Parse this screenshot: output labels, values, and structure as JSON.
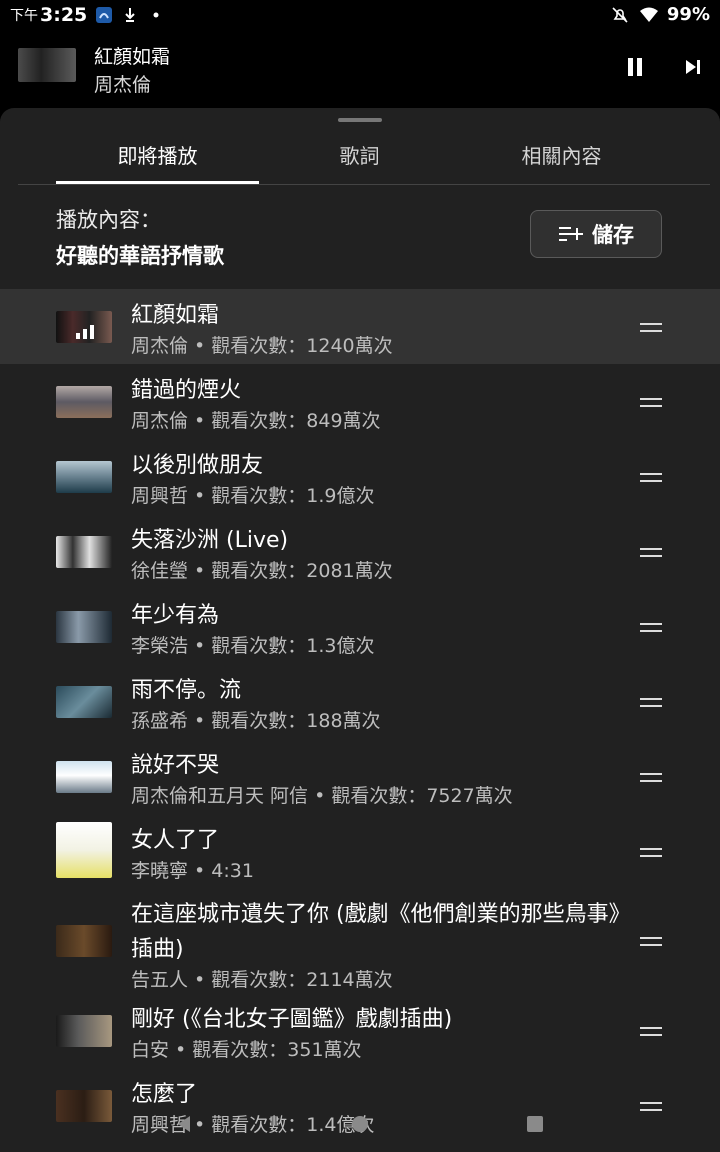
{
  "status_bar": {
    "time_prefix": "下午",
    "time": "3:25",
    "battery": "99%",
    "icons_left": [
      "app-notification-icon",
      "download-icon",
      "dot-icon"
    ],
    "icons_right": [
      "mute-icon",
      "wifi-icon",
      "battery-icon"
    ]
  },
  "mini_player": {
    "title": "紅顏如霜",
    "artist": "周杰倫"
  },
  "tabs": [
    {
      "label": "即將播放"
    },
    {
      "label": "歌詞"
    },
    {
      "label": "相關內容"
    }
  ],
  "playlist": {
    "label": "播放內容：",
    "name": "好聽的華語抒情歌",
    "save_label": "儲存"
  },
  "items": [
    {
      "title": "紅顏如霜",
      "meta": "周杰倫 • 觀看次數：1240萬次"
    },
    {
      "title": "錯過的煙火",
      "meta": "周杰倫 • 觀看次數：849萬次"
    },
    {
      "title": "以後別做朋友",
      "meta": "周興哲 • 觀看次數：1.9億次"
    },
    {
      "title": "失落沙洲 (Live)",
      "meta": "徐佳瑩 • 觀看次數：2081萬次"
    },
    {
      "title": "年少有為",
      "meta": "李榮浩 • 觀看次數：1.3億次"
    },
    {
      "title": "雨不停。流",
      "meta": "孫盛希 • 觀看次數：188萬次"
    },
    {
      "title": "說好不哭",
      "meta": "周杰倫和五月天 阿信 • 觀看次數：7527萬次"
    },
    {
      "title": "女人了了",
      "meta": "李曉寧 • 4:31"
    },
    {
      "title": "在這座城市遺失了你 (戲劇《他們創業的那些鳥事》插曲)",
      "meta": "告五人 • 觀看次數：2114萬次"
    },
    {
      "title": "剛好 (《台北女子圖鑑》戲劇插曲)",
      "meta": "白安 • 觀看次數：351萬次"
    },
    {
      "title": "怎麼了",
      "meta": "周興哲 • 觀看次數：1.4億次"
    }
  ]
}
